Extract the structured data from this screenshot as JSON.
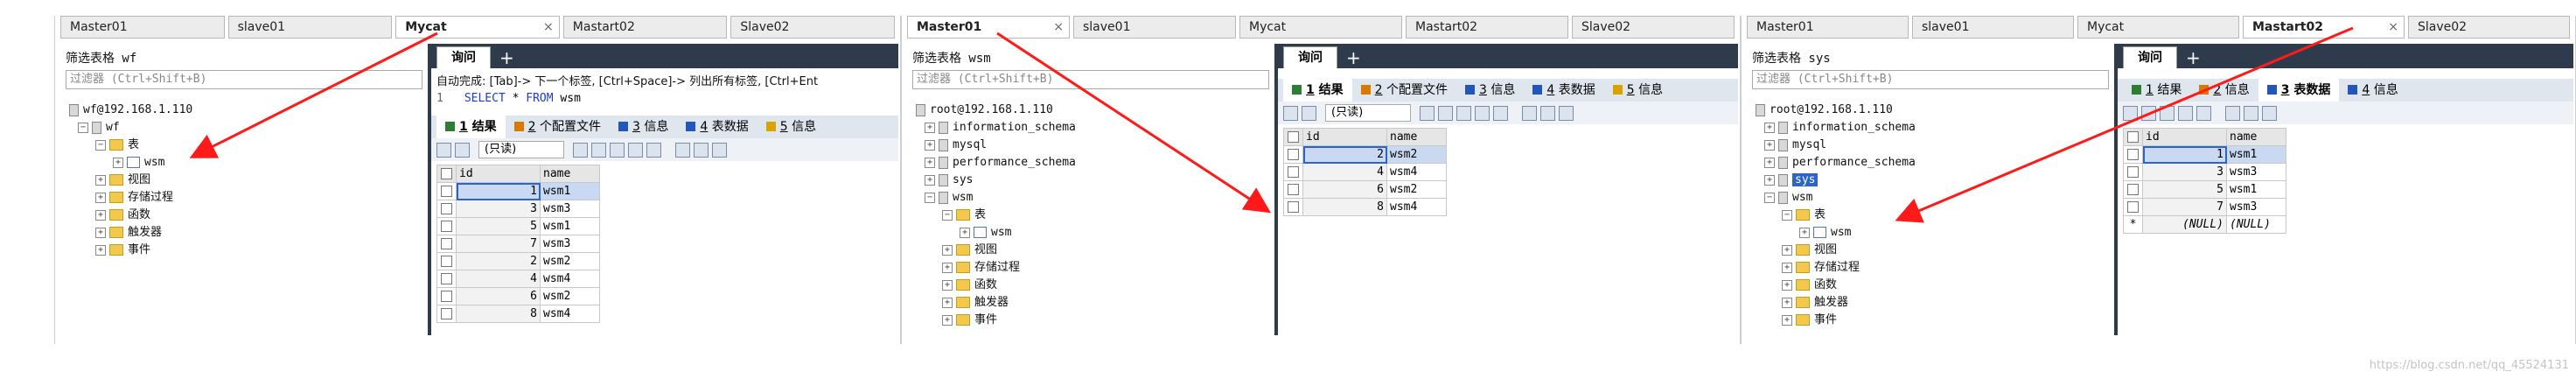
{
  "panel1": {
    "tabs": [
      "Master01",
      "slave01",
      "Mycat",
      "Mastart02",
      "Slave02"
    ],
    "active_tab": 2,
    "filter_label": "筛选表格 wf",
    "filter_placeholder": "过滤器 (Ctrl+Shift+B)",
    "tree": {
      "root": "wf@192.168.1.110",
      "db": "wf",
      "tables_folder": "表",
      "table": "wsm",
      "folders": [
        "视图",
        "存储过程",
        "函数",
        "触发器",
        "事件"
      ]
    },
    "query_tab": "询问",
    "autocomplete": "自动完成: [Tab]-> 下一个标签, [Ctrl+Space]-> 列出所有标签, [Ctrl+Ent",
    "sql": {
      "line": "1",
      "select": "SELECT",
      "star": "*",
      "from": "FROM",
      "table": "wsm"
    },
    "result_tabs": [
      {
        "num": "1",
        "label": "结果"
      },
      {
        "num": "2",
        "label": "个配置文件"
      },
      {
        "num": "3",
        "label": "信息"
      },
      {
        "num": "4",
        "label": "表数据"
      },
      {
        "num": "5",
        "label": "信息"
      }
    ],
    "active_result": 0,
    "toolbar_select": "(只读)",
    "columns": [
      "id",
      "name"
    ],
    "rows": [
      [
        "1",
        "wsm1"
      ],
      [
        "3",
        "wsm3"
      ],
      [
        "5",
        "wsm1"
      ],
      [
        "7",
        "wsm3"
      ],
      [
        "2",
        "wsm2"
      ],
      [
        "4",
        "wsm4"
      ],
      [
        "6",
        "wsm2"
      ],
      [
        "8",
        "wsm4"
      ]
    ]
  },
  "panel2": {
    "tabs": [
      "Master01",
      "slave01",
      "Mycat",
      "Mastart02",
      "Slave02"
    ],
    "active_tab": 0,
    "filter_label": "筛选表格 wsm",
    "filter_placeholder": "过滤器 (Ctrl+Shift+B)",
    "tree": {
      "root": "root@192.168.1.110",
      "dbs": [
        "information_schema",
        "mysql",
        "performance_schema",
        "sys",
        "wsm"
      ],
      "tables_folder": "表",
      "table": "wsm",
      "folders": [
        "视图",
        "存储过程",
        "函数",
        "触发器",
        "事件"
      ]
    },
    "query_tab": "询问",
    "result_tabs": [
      {
        "num": "1",
        "label": "结果"
      },
      {
        "num": "2",
        "label": "个配置文件"
      },
      {
        "num": "3",
        "label": "信息"
      },
      {
        "num": "4",
        "label": "表数据"
      },
      {
        "num": "5",
        "label": "信息"
      }
    ],
    "active_result": 0,
    "toolbar_select": "(只读)",
    "columns": [
      "id",
      "name"
    ],
    "rows": [
      [
        "2",
        "wsm2"
      ],
      [
        "4",
        "wsm4"
      ],
      [
        "6",
        "wsm2"
      ],
      [
        "8",
        "wsm4"
      ]
    ]
  },
  "panel3": {
    "tabs": [
      "Master01",
      "slave01",
      "Mycat",
      "Mastart02",
      "Slave02"
    ],
    "active_tab": 3,
    "filter_label": "筛选表格 sys",
    "filter_placeholder": "过滤器 (Ctrl+Shift+B)",
    "tree": {
      "root": "root@192.168.1.110",
      "dbs": [
        "information_schema",
        "mysql",
        "performance_schema",
        "sys",
        "wsm"
      ],
      "tables_folder": "表",
      "table": "wsm",
      "folders": [
        "视图",
        "存储过程",
        "函数",
        "触发器",
        "事件"
      ]
    },
    "query_tab": "询问",
    "result_tabs": [
      {
        "num": "1",
        "label": "结果"
      },
      {
        "num": "2",
        "label": "信息"
      },
      {
        "num": "3",
        "label": "表数据"
      },
      {
        "num": "4",
        "label": "信息"
      }
    ],
    "active_result": 2,
    "columns": [
      "id",
      "name"
    ],
    "rows": [
      [
        "1",
        "wsm1"
      ],
      [
        "3",
        "wsm3"
      ],
      [
        "5",
        "wsm1"
      ],
      [
        "7",
        "wsm3"
      ],
      [
        "(NULL)",
        "(NULL)"
      ]
    ]
  },
  "watermark": "https://blog.csdn.net/qq_45524131",
  "colors": {
    "arrow": "#ff1a1a",
    "header_dark": "#2e3b4b",
    "selection": "#2d64c8"
  }
}
